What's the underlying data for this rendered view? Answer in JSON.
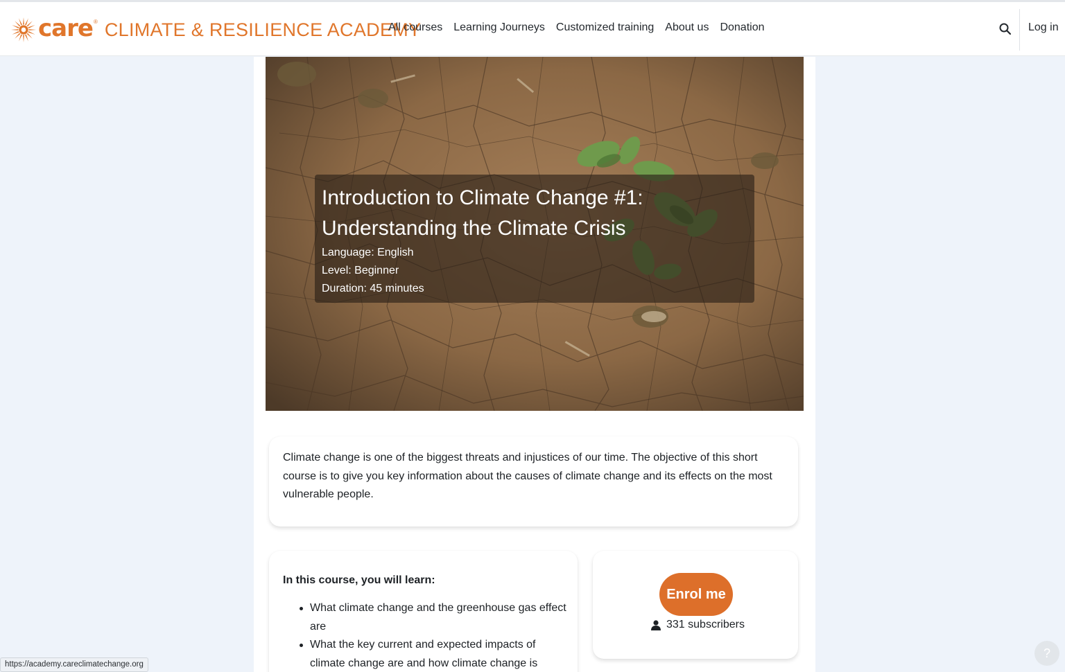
{
  "brand": {
    "care": "care",
    "registered": "®",
    "academy": "CLIMATE & RESILIENCE ACADEMY",
    "color": "#e0762b"
  },
  "nav": {
    "items": [
      {
        "label": "All courses"
      },
      {
        "label": "Learning Journeys"
      },
      {
        "label": "Customized training"
      },
      {
        "label": "About us"
      },
      {
        "label": "Donation"
      }
    ],
    "search_icon": "search-icon",
    "login_label": "Log in"
  },
  "hero": {
    "title": "Introduction to Climate Change #1: Understanding the Climate Crisis",
    "language": "Language: English",
    "level": "Level: Beginner",
    "duration": "Duration: 45 minutes"
  },
  "summary": {
    "text": "Climate change is one of the biggest threats and injustices of our time. The objective of this short course is to give you key information about the causes of climate change and its effects on the most vulnerable people."
  },
  "learn": {
    "title": "In this course, you will learn:",
    "items": [
      {
        "text": "What climate change and the greenhouse gas effect are"
      },
      {
        "text": "What the key current and expected impacts of climate change are and how climate change is"
      }
    ]
  },
  "enrol": {
    "button_label": "Enrol me",
    "subscribers": "331 subscribers",
    "user_icon": "user-icon",
    "button_color": "#dd6f2a"
  },
  "status_bar": {
    "url": "https://academy.careclimatechange.org"
  },
  "help": {
    "label": "?"
  }
}
